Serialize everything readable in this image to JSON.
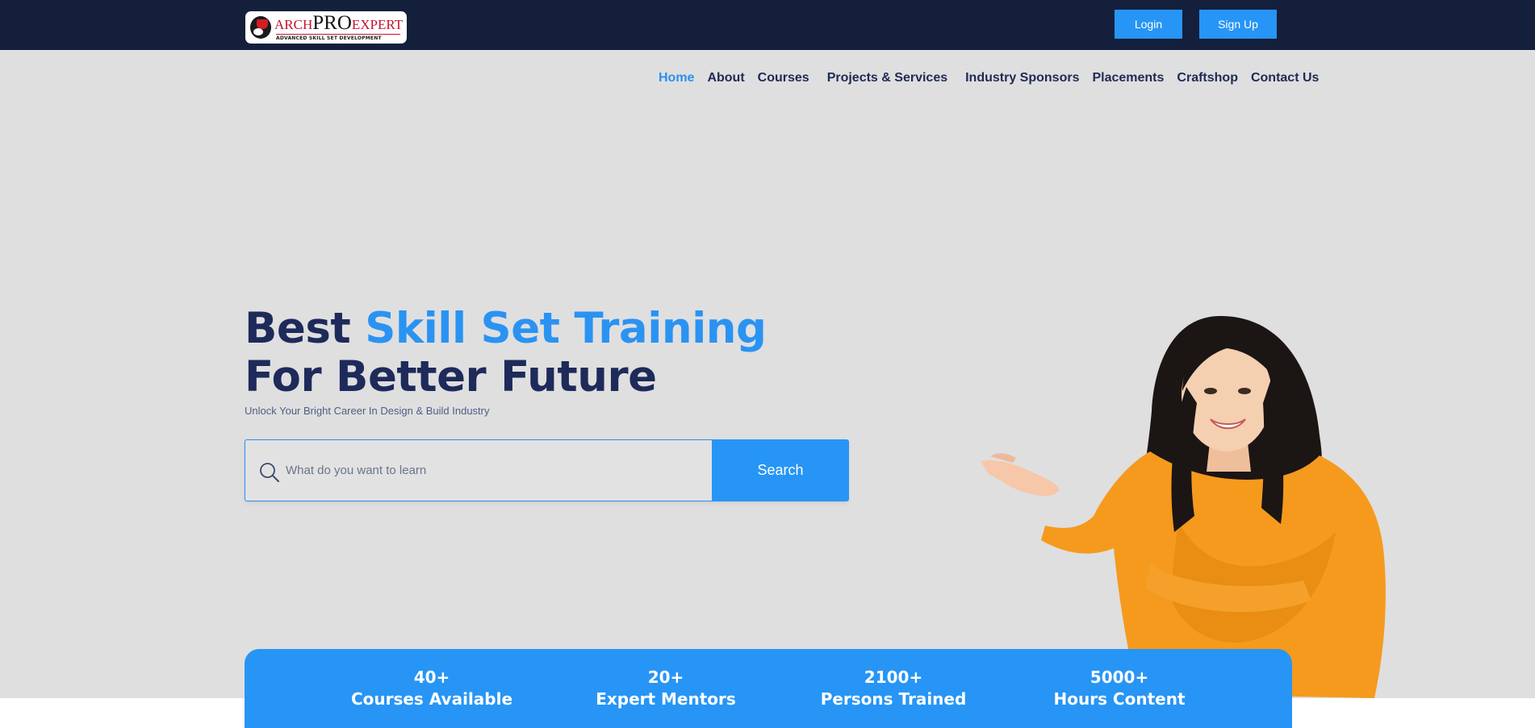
{
  "header": {
    "logo": {
      "word_arch": "ARCH",
      "word_pro": "PRO",
      "word_expert": "EXPERT",
      "tagline": "ADVANCED SKILL SET DEVELOPMENT"
    },
    "login_label": "Login",
    "signup_label": "Sign Up"
  },
  "nav": {
    "items": [
      {
        "label": "Home",
        "active": true
      },
      {
        "label": "About"
      },
      {
        "label": "Courses"
      },
      {
        "label": "Projects & Services"
      },
      {
        "label": "Industry Sponsors"
      },
      {
        "label": "Placements"
      },
      {
        "label": "Craftshop"
      },
      {
        "label": "Contact Us"
      }
    ]
  },
  "hero": {
    "title_part1": "Best ",
    "title_accent": "Skill Set Training",
    "title_part2": " For Better Future",
    "subtitle": "Unlock Your Bright Career In Design & Build Industry",
    "search_placeholder": "What do you want to learn",
    "search_button": "Search"
  },
  "stats": [
    {
      "value": "40+",
      "label": "Courses Available"
    },
    {
      "value": "20+",
      "label": "Expert Mentors"
    },
    {
      "value": "2100+",
      "label": "Persons Trained"
    },
    {
      "value": "5000+",
      "label": "Hours Content"
    }
  ],
  "colors": {
    "topbar": "#141f3c",
    "accent": "#2795f5",
    "hero_bg": "#dfdfe0",
    "heading": "#1e2a5a"
  }
}
